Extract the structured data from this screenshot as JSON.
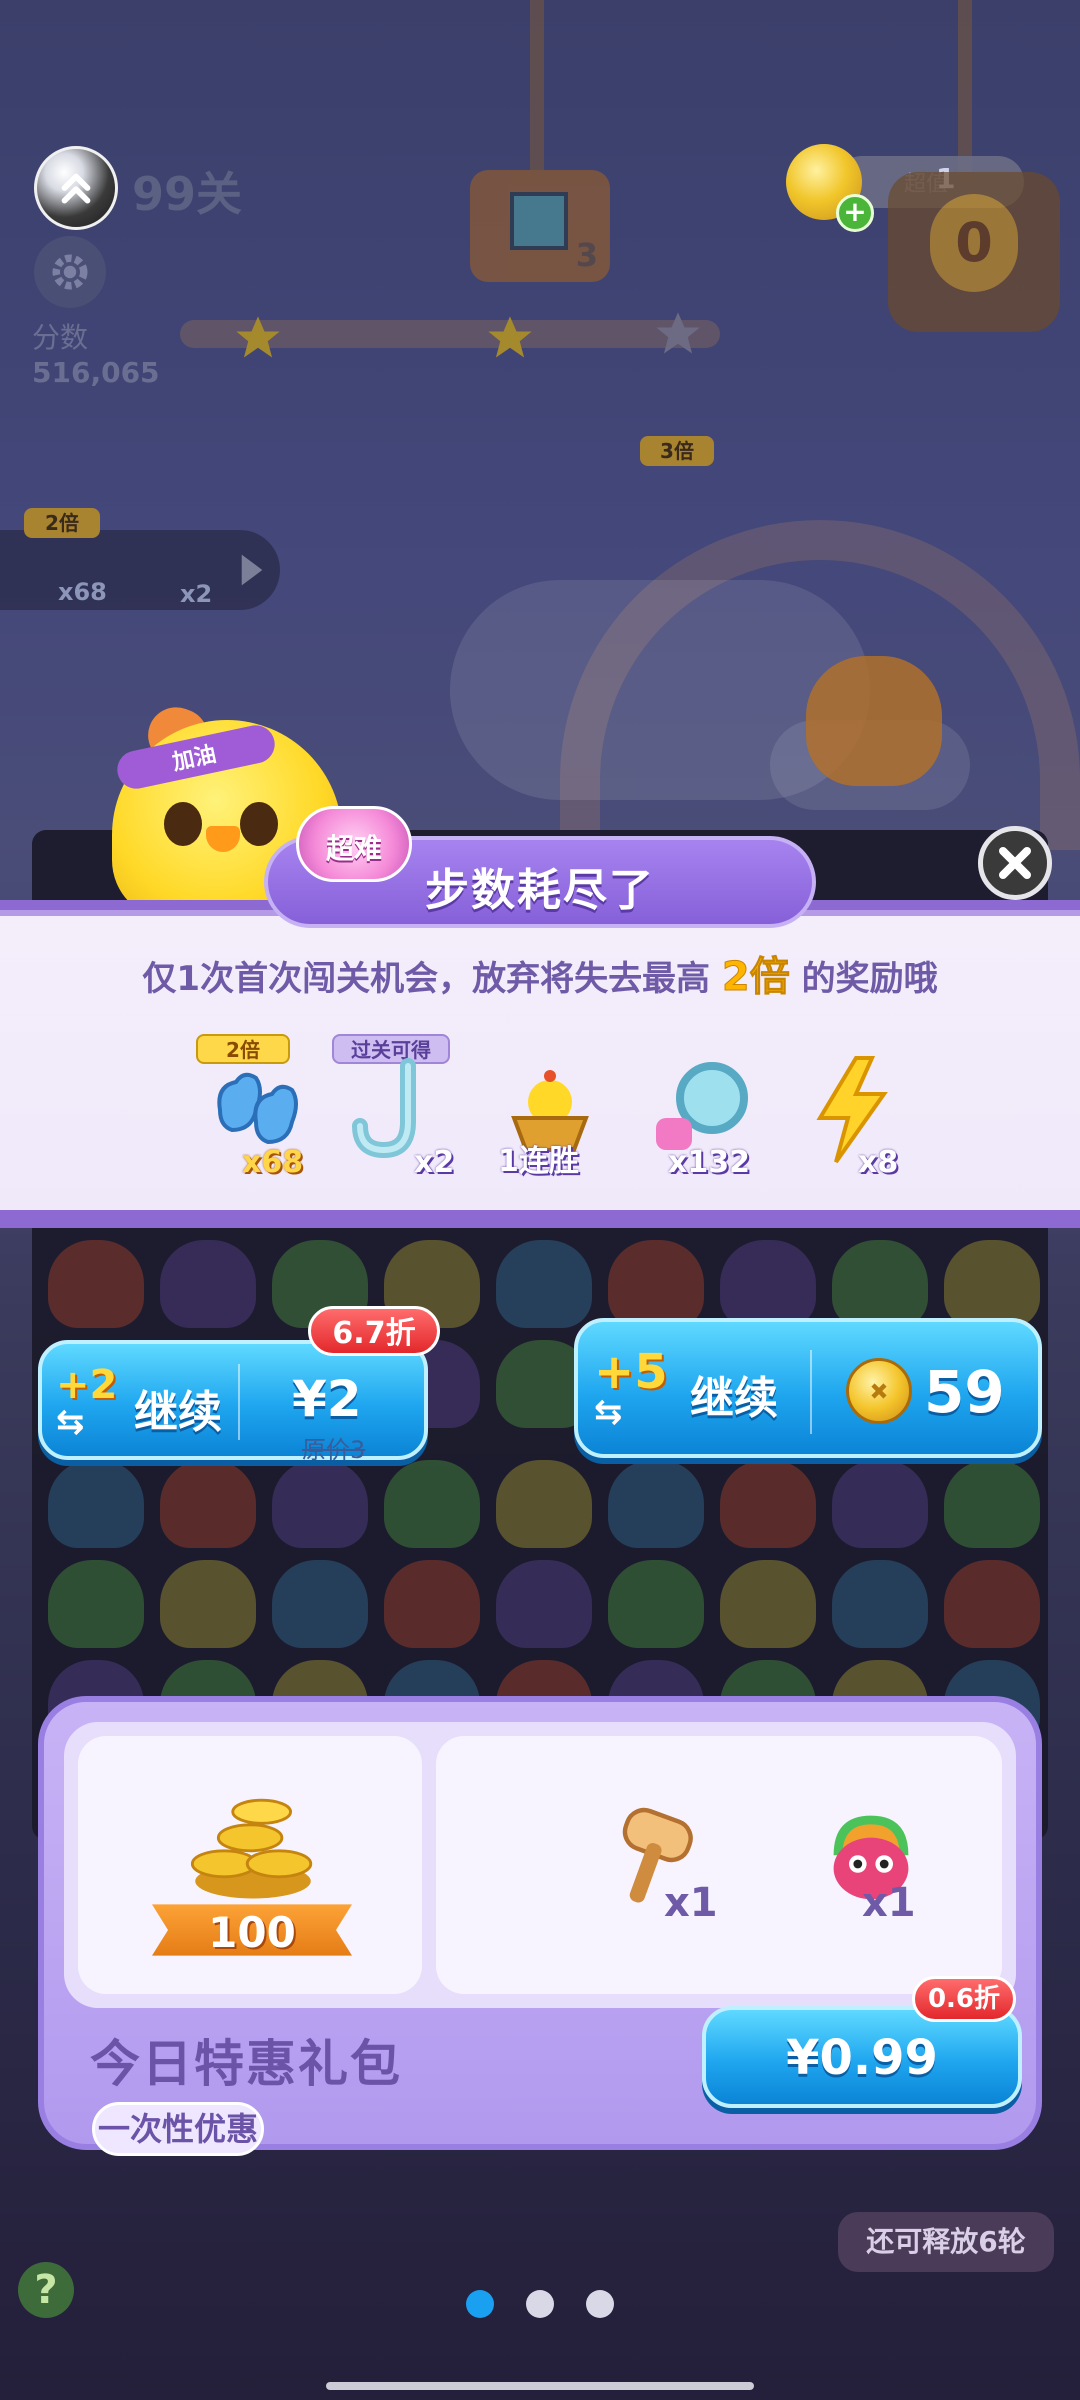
{
  "hud": {
    "level": "99关",
    "score_label": "分数",
    "score": "516,065",
    "goal_count": "3",
    "multiplier_tag": "3倍",
    "coins": "1",
    "coin_bar_faded": "超值",
    "chest_value": "0"
  },
  "booster_bar": {
    "tag": "2倍",
    "item1_count": "x68",
    "item2_count": "x2"
  },
  "chick_band": "加油",
  "dialog": {
    "difficulty_badge": "超难",
    "title": "步数耗尽了",
    "message_prefix": "仅1次首次闯关机会，放弃将失去最高 ",
    "message_highlight": "2倍",
    "message_suffix": " 的奖励哦",
    "rewards": [
      {
        "icon": "gloves-icon",
        "tag": "2倍",
        "count": "x68"
      },
      {
        "icon": "hook-icon",
        "tag": "过关可得",
        "count": "x2"
      },
      {
        "icon": "chick-basket-icon",
        "tag": "",
        "count": "1连胜"
      },
      {
        "icon": "magnifier-icon",
        "tag": "",
        "count": "x132"
      },
      {
        "icon": "lightning-icon",
        "tag": "",
        "count": "x8"
      }
    ]
  },
  "continue_cash": {
    "plus": "+2",
    "label": "继续",
    "price": "¥2",
    "original_price": "原价3",
    "discount": "6.7折"
  },
  "continue_coins": {
    "plus": "+5",
    "label": "继续",
    "price": "59"
  },
  "gift_pack": {
    "coin_amount": "100",
    "item1_count": "x1",
    "item2_count": "x1",
    "title": "今日特惠礼包",
    "tag": "一次性优惠",
    "price": "¥0.99",
    "discount": "0.6折"
  },
  "footer": {
    "release_text": "还可释放6轮",
    "help": "?"
  },
  "colors": {
    "accent_purple": "#8d6ad1",
    "button_blue": "#1fa6ef",
    "discount_red": "#e3282c",
    "highlight_gold": "#ffb400"
  }
}
